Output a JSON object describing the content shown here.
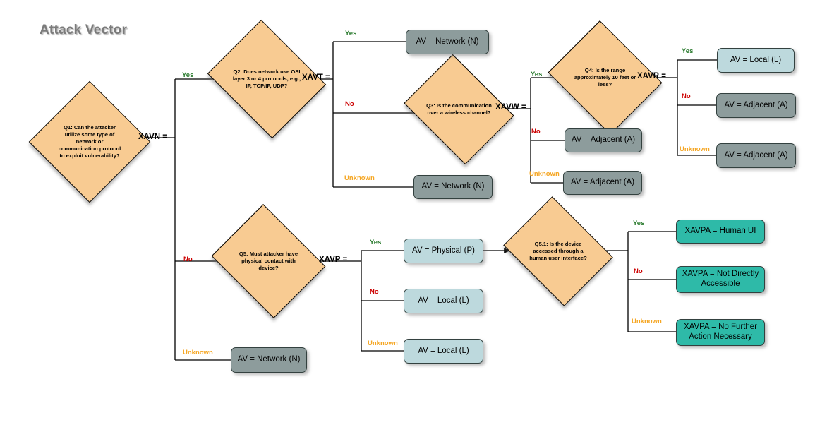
{
  "title": "Attack Vector",
  "edge_labels": {
    "yes": "Yes",
    "no": "No",
    "unknown": "Unknown"
  },
  "decisions": [
    {
      "id": "q1",
      "text": "Q1: Can the attacker utilize some type of network or communication protocol to exploit vulnerability?",
      "var_label": "XAVN ="
    },
    {
      "id": "q2",
      "text": "Q2: Does network use OSI layer 3 or 4 protocols, e.g., IP, TCP/IP, UDP?",
      "var_label": "XAVT ="
    },
    {
      "id": "q3",
      "text": "Q3: Is the communication over a wireless channel?",
      "var_label": "XAVW ="
    },
    {
      "id": "q4",
      "text": "Q4: Is the range approximately  10 feet or less?",
      "var_label": "XAVR ="
    },
    {
      "id": "q5",
      "text": "Q5: Must attacker have physical contact with device?",
      "var_label": "XAVP ="
    },
    {
      "id": "q51",
      "text": "Q5.1: Is the device accessed through a human user interface?",
      "var_label": ""
    }
  ],
  "results": [
    {
      "id": "r_q2_yes",
      "text": "AV = Network (N)",
      "color": "gray"
    },
    {
      "id": "r_q2_unk",
      "text": "AV = Network (N)",
      "color": "gray"
    },
    {
      "id": "r_q3_no",
      "text": "AV = Adjacent (A)",
      "color": "gray"
    },
    {
      "id": "r_q3_unk",
      "text": "AV = Adjacent (A)",
      "color": "gray"
    },
    {
      "id": "r_q4_yes",
      "text": "AV = Local (L)",
      "color": "blue"
    },
    {
      "id": "r_q4_no",
      "text": "AV = Adjacent (A)",
      "color": "gray"
    },
    {
      "id": "r_q4_unk",
      "text": "AV = Adjacent (A)",
      "color": "gray"
    },
    {
      "id": "r_q1_unk",
      "text": "AV = Network (N)",
      "color": "gray"
    },
    {
      "id": "r_q5_yes",
      "text": "AV = Physical (P)",
      "color": "blue"
    },
    {
      "id": "r_q5_no",
      "text": "AV = Local (L)",
      "color": "blue"
    },
    {
      "id": "r_q5_unk",
      "text": "AV = Local (L)",
      "color": "blue"
    },
    {
      "id": "r_q51_yes",
      "text": "XAVPA = Human UI",
      "color": "teal"
    },
    {
      "id": "r_q51_no",
      "text": "XAVPA = Not Directly Accessible",
      "color": "teal"
    },
    {
      "id": "r_q51_unk",
      "text": "XAVPA = No Further Action Necessary",
      "color": "teal"
    }
  ],
  "colors": {
    "decision_fill": "#f8cb92",
    "gray_fill": "#8d9c9c",
    "blue_fill": "#bdd9dd",
    "teal_fill": "#2ebaa8",
    "yes": "#2e7d32",
    "no": "#cc0000",
    "unknown": "#f5a623",
    "title": "#7b7b7b"
  }
}
